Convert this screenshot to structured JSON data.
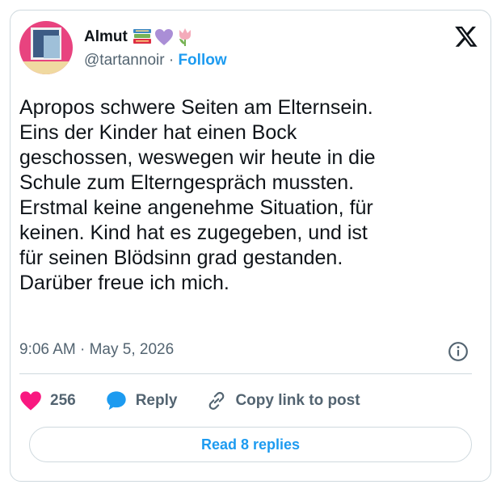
{
  "author": {
    "name": "Almut",
    "handle": "@tartannoir",
    "separator": "·",
    "follow_label": "Follow",
    "emojis": [
      "books-emoji",
      "purple-heart-emoji",
      "tulip-emoji"
    ]
  },
  "tweet": {
    "lines": [
      "Apropos schwere Seiten am Elternsein.",
      "Eins der Kinder hat einen Bock",
      "geschossen, weswegen wir heute in die",
      "Schule zum Elterngespräch mussten.",
      "Erstmal keine angenehme Situation, für",
      "keinen. Kind hat es zugegeben, und ist",
      "für seinen Blödsinn grad gestanden.",
      "Darüber freue ich mich."
    ],
    "timestamp": "9:06 AM · May 5, 2026"
  },
  "actions": {
    "like_count": "256",
    "reply_label": "Reply",
    "copy_link_label": "Copy link to post"
  },
  "footer": {
    "read_replies_label": "Read 8 replies"
  },
  "colors": {
    "accent": "#1d9bf0",
    "heart": "#f91880",
    "muted": "#536471",
    "border": "#cfd9de"
  }
}
